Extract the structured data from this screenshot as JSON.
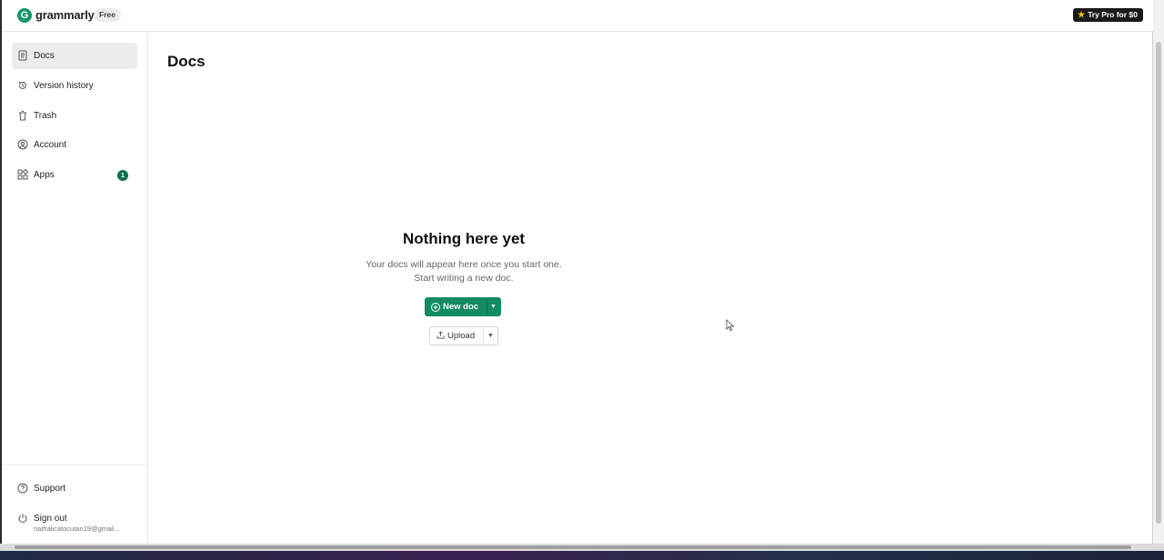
{
  "app": {
    "logo_text": "grammarly",
    "logo_letter": "G",
    "plan_badge": "Free",
    "pro_button": "Try Pro for $0",
    "brand_color": "#15966a"
  },
  "sidebar": {
    "items": [
      {
        "label": "Docs",
        "icon": "doc-icon",
        "active": true
      },
      {
        "label": "Version history",
        "icon": "history-icon"
      },
      {
        "label": "Trash",
        "icon": "trash-icon"
      },
      {
        "label": "Account",
        "icon": "account-icon"
      },
      {
        "label": "Apps",
        "icon": "apps-icon",
        "badge": "1"
      }
    ],
    "support": "Support",
    "sign_out": "Sign out",
    "email": "nathalicatocutan19@gmail..."
  },
  "main": {
    "title": "Docs",
    "empty_title": "Nothing here yet",
    "empty_line1": "Your docs will appear here once you start one.",
    "empty_line2": "Start writing a new doc.",
    "new_doc": "New doc",
    "upload": "Upload"
  }
}
